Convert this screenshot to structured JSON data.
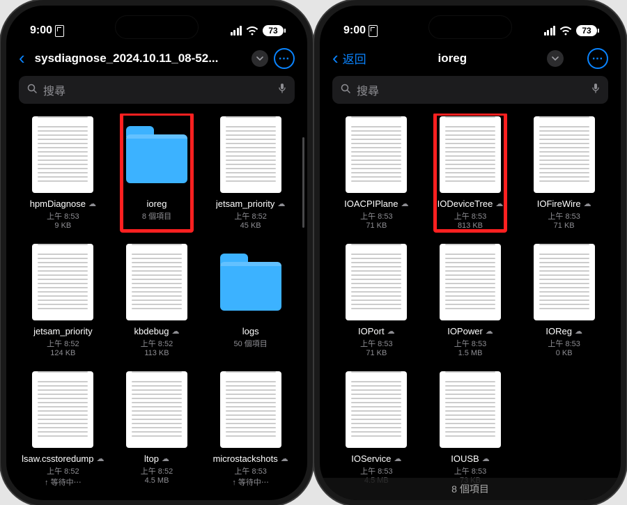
{
  "status": {
    "time": "9:00",
    "battery": "73"
  },
  "search_placeholder": "搜尋",
  "left": {
    "title": "sysdiagnose_2024.10.11_08-52...",
    "items": [
      {
        "name": "hpmDiagnose",
        "type": "doc",
        "cloud": true,
        "line1": "上午 8:53",
        "line2": "9 KB"
      },
      {
        "name": "ioreg",
        "type": "folder",
        "cloud": false,
        "line1": "8 個項目",
        "line2": "",
        "highlight": true
      },
      {
        "name": "jetsam_priority",
        "type": "doc",
        "cloud": true,
        "line1": "上午 8:52",
        "line2": "45 KB"
      },
      {
        "name": "jetsam_priority",
        "type": "doc",
        "cloud": false,
        "line1": "上午 8:52",
        "line2": "124 KB"
      },
      {
        "name": "kbdebug",
        "type": "doc",
        "cloud": true,
        "line1": "上午 8:52",
        "line2": "113 KB"
      },
      {
        "name": "logs",
        "type": "folder",
        "cloud": false,
        "line1": "50 個項目",
        "line2": ""
      },
      {
        "name": "lsaw.csstoredump",
        "type": "doc",
        "cloud": true,
        "line1": "上午 8:52",
        "line2": "↑ 等待中⋯"
      },
      {
        "name": "ltop",
        "type": "doc",
        "cloud": true,
        "line1": "上午 8:52",
        "line2": "4.5 MB"
      },
      {
        "name": "microstackshots",
        "type": "doc",
        "cloud": true,
        "line1": "上午 8:53",
        "line2": "↑ 等待中⋯"
      }
    ]
  },
  "right": {
    "back_label": "返回",
    "title": "ioreg",
    "footer": "8 個項目",
    "items": [
      {
        "name": "IOACPIPlane",
        "type": "doc",
        "cloud": true,
        "line1": "上午 8:53",
        "line2": "71 KB"
      },
      {
        "name": "IODeviceTree",
        "type": "doc",
        "cloud": true,
        "line1": "上午 8:53",
        "line2": "813 KB",
        "highlight": true
      },
      {
        "name": "IOFireWire",
        "type": "doc",
        "cloud": true,
        "line1": "上午 8:53",
        "line2": "71 KB"
      },
      {
        "name": "IOPort",
        "type": "doc",
        "cloud": true,
        "line1": "上午 8:53",
        "line2": "71 KB"
      },
      {
        "name": "IOPower",
        "type": "doc",
        "cloud": true,
        "line1": "上午 8:53",
        "line2": "1.5 MB"
      },
      {
        "name": "IOReg",
        "type": "doc",
        "cloud": true,
        "line1": "上午 8:53",
        "line2": "0 KB"
      },
      {
        "name": "IOService",
        "type": "doc",
        "cloud": true,
        "line1": "上午 8:53",
        "line2": "4.5 MB"
      },
      {
        "name": "IOUSB",
        "type": "doc",
        "cloud": true,
        "line1": "上午 8:53",
        "line2": "73 KB"
      }
    ]
  }
}
